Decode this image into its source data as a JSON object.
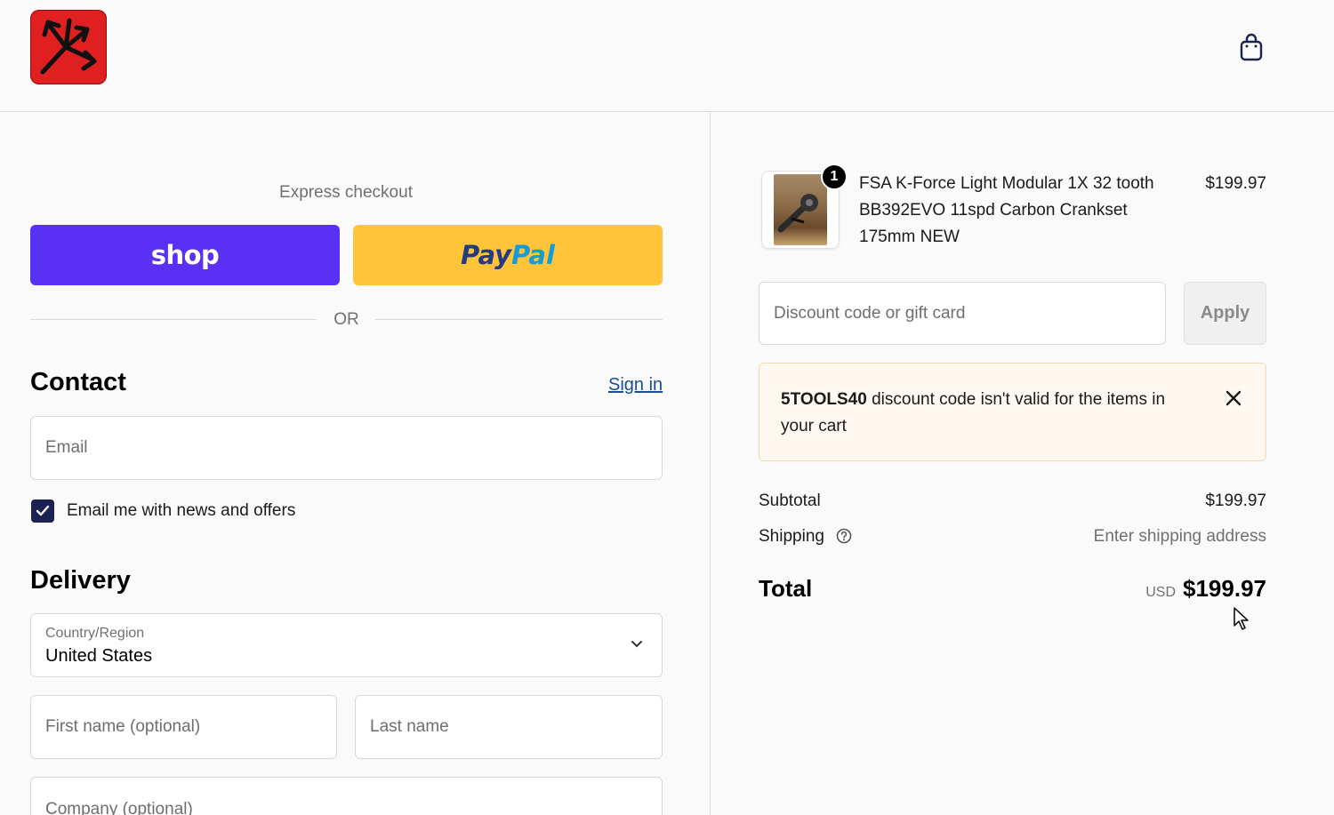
{
  "header": {
    "logo_icon": "arrows-logo-icon",
    "cart_icon": "shopping-bag-icon"
  },
  "express": {
    "title": "Express checkout",
    "shop_label": "shop",
    "paypal_label_a": "Pay",
    "paypal_label_b": "Pal",
    "or_label": "OR"
  },
  "contact": {
    "heading": "Contact",
    "sign_in": "Sign in",
    "email_placeholder": "Email",
    "email_value": "",
    "newsletter_label": "Email me with news and offers",
    "newsletter_checked": true
  },
  "delivery": {
    "heading": "Delivery",
    "country_label": "Country/Region",
    "country_value": "United States",
    "first_name_placeholder": "First name (optional)",
    "last_name_placeholder": "Last name",
    "company_placeholder": "Company (optional)"
  },
  "order": {
    "item": {
      "quantity": "1",
      "name": "FSA K-Force Light Modular 1X 32 tooth BB392EVO 11spd Carbon Crankset 175mm NEW",
      "price": "$199.97"
    },
    "discount_placeholder": "Discount code or gift card",
    "apply_label": "Apply",
    "alert": {
      "code": "5TOOLS40",
      "message": " discount code isn't valid for the items in your cart"
    },
    "subtotal_label": "Subtotal",
    "subtotal_value": "$199.97",
    "shipping_label": "Shipping",
    "shipping_value": "Enter shipping address",
    "total_label": "Total",
    "currency": "USD",
    "total_value": "$199.97"
  },
  "colors": {
    "shop_purple": "#5a31f4",
    "paypal_yellow": "#ffc439",
    "checkbox_navy": "#1b2251",
    "link_blue": "#1a4c8f",
    "alert_bg": "#fff8f1"
  }
}
